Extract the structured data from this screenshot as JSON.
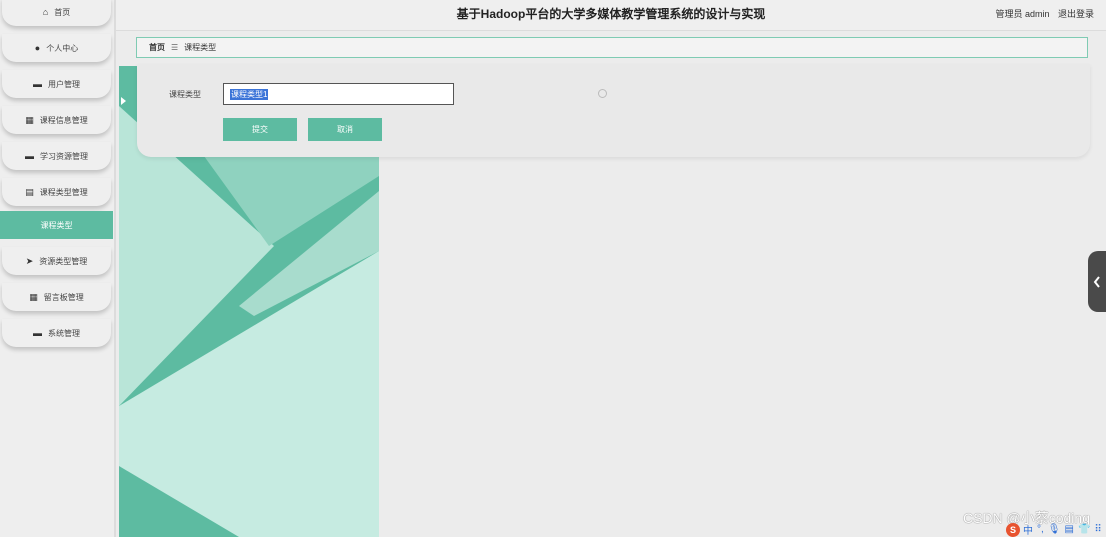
{
  "app": {
    "title": "基于Hadoop平台的大学多媒体教学管理系统的设计与实现",
    "user_label": "管理员 admin",
    "logout_label": "退出登录"
  },
  "sidebar": {
    "items": [
      {
        "label": "首页",
        "icon": "home-icon",
        "glyph": "⌂"
      },
      {
        "label": "个人中心",
        "icon": "user-icon",
        "glyph": "●"
      },
      {
        "label": "用户管理",
        "icon": "users-icon",
        "glyph": "▬"
      },
      {
        "label": "课程信息管理",
        "icon": "grid-icon",
        "glyph": "▦"
      },
      {
        "label": "学习资源管理",
        "icon": "monitor-icon",
        "glyph": "▬"
      },
      {
        "label": "课程类型管理",
        "icon": "clipboard-icon",
        "glyph": "▤"
      },
      {
        "label": "资源类型管理",
        "icon": "send-icon",
        "glyph": "➤"
      },
      {
        "label": "留言板管理",
        "icon": "grid-icon",
        "glyph": "▦"
      },
      {
        "label": "系统管理",
        "icon": "briefcase-icon",
        "glyph": "▬"
      }
    ],
    "active_sub": "课程类型"
  },
  "breadcrumb": {
    "home": "首页",
    "separator": "☰",
    "current": "课程类型"
  },
  "form": {
    "field_label": "课程类型",
    "field_value": "课程类型1",
    "submit_label": "提交",
    "cancel_label": "取消"
  },
  "watermark": "CSDN @小蔡coding",
  "ime": {
    "logo": "S",
    "items": [
      "中",
      "°,",
      "🎙",
      "▤",
      "👕",
      "⠿"
    ]
  },
  "colors": {
    "accent": "#5dbba1",
    "accent_light": "#b6e3d6",
    "background": "#ececec"
  }
}
